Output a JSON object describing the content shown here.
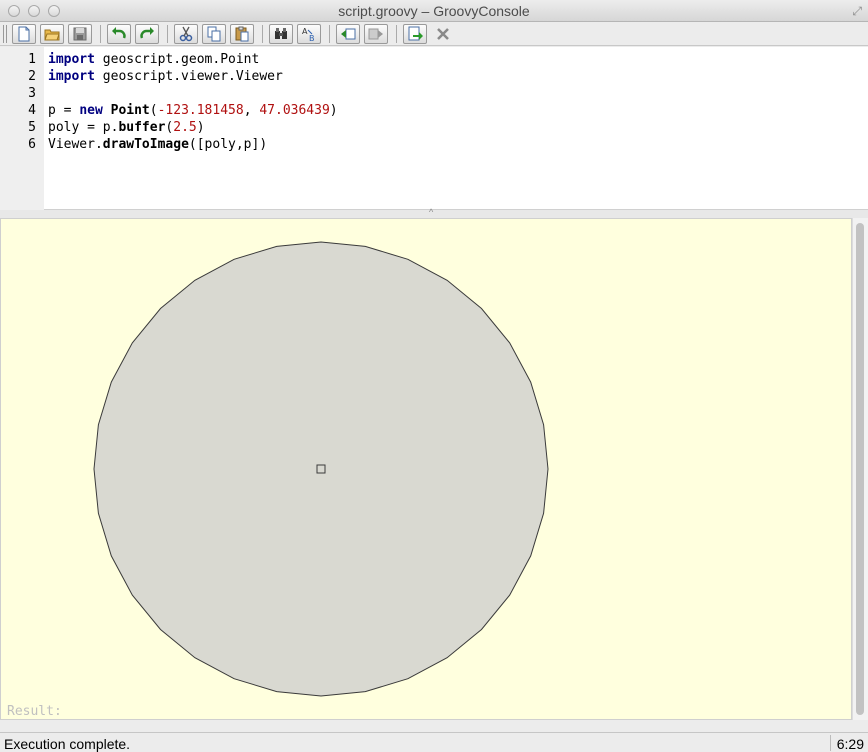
{
  "window": {
    "title": "script.groovy – GroovyConsole"
  },
  "toolbar": {
    "buttons": [
      {
        "icon": "new-file-icon"
      },
      {
        "icon": "open-folder-icon"
      },
      {
        "icon": "save-icon"
      },
      {
        "icon": "undo-icon"
      },
      {
        "icon": "redo-icon"
      },
      {
        "icon": "cut-icon"
      },
      {
        "icon": "copy-icon"
      },
      {
        "icon": "paste-icon"
      },
      {
        "icon": "find-icon"
      },
      {
        "icon": "replace-icon"
      },
      {
        "icon": "history-back-icon"
      },
      {
        "icon": "history-forward-icon"
      },
      {
        "icon": "run-script-icon"
      },
      {
        "icon": "interrupt-icon"
      }
    ]
  },
  "editor": {
    "line_numbers": [
      "1",
      "2",
      "3",
      "4",
      "5",
      "6"
    ],
    "lines": {
      "l1": {
        "kw": "import",
        "rest": " geoscript.geom.Point"
      },
      "l2": {
        "kw": "import",
        "rest": " geoscript.viewer.Viewer"
      },
      "l4": {
        "a": "p = ",
        "kw": "new",
        "sp": " ",
        "fn": "Point",
        "b": "(",
        "n1": "-123.181458",
        "c": ", ",
        "n2": "47.036439",
        "d": ")"
      },
      "l5": {
        "a": "poly = p.",
        "fn": "buffer",
        "b": "(",
        "n1": "2.5",
        "d": ")"
      },
      "l6": {
        "a": "Viewer.",
        "fn": "drawToImage",
        "b": "([poly,p])"
      }
    }
  },
  "output": {
    "result_label": "Result:",
    "colors": {
      "background": "#ffffde",
      "polygon_fill": "#d9d9d1",
      "polygon_stroke": "#3a3a3a"
    }
  },
  "status": {
    "message": "Execution complete.",
    "caret_position": "6:29"
  }
}
